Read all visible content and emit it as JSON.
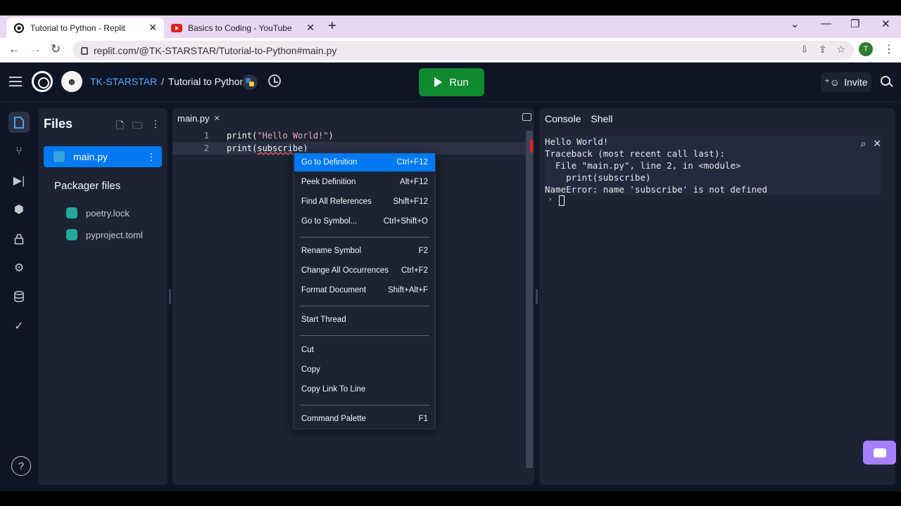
{
  "browser": {
    "tabs": [
      {
        "title": "Tutorial to Python - Replit",
        "active": true
      },
      {
        "title": "Basics to Coding - YouTube",
        "active": false
      }
    ],
    "url": "replit.com/@TK-STARSTAR/Tutorial-to-Python#main.py",
    "profile_initial": "T"
  },
  "header": {
    "owner": "TK-STARSTAR",
    "separator": "/",
    "project": "Tutorial to Python",
    "run_label": "Run",
    "invite_label": "Invite"
  },
  "files": {
    "title": "Files",
    "active_file": "main.py",
    "group_title": "Packager files",
    "items": [
      "poetry.lock",
      "pyproject.toml"
    ]
  },
  "editor": {
    "tab": "main.py",
    "lines": [
      {
        "num": "1",
        "pre": "print(",
        "str": "\"Hello World!\"",
        "post": ")"
      },
      {
        "num": "2",
        "pre": "print(",
        "err": "subscribe",
        "post": ")"
      }
    ]
  },
  "context_menu": {
    "items": [
      {
        "label": "Go to Definition",
        "shortcut": "Ctrl+F12"
      },
      {
        "label": "Peek Definition",
        "shortcut": "Alt+F12"
      },
      {
        "label": "Find All References",
        "shortcut": "Shift+F12"
      },
      {
        "label": "Go to Symbol...",
        "shortcut": "Ctrl+Shift+O"
      },
      {
        "label": "Rename Symbol",
        "shortcut": "F2"
      },
      {
        "label": "Change All Occurrences",
        "shortcut": "Ctrl+F2"
      },
      {
        "label": "Format Document",
        "shortcut": "Shift+Alt+F"
      },
      {
        "label": "Start Thread",
        "shortcut": ""
      },
      {
        "label": "Cut",
        "shortcut": ""
      },
      {
        "label": "Copy",
        "shortcut": ""
      },
      {
        "label": "Copy Link To Line",
        "shortcut": ""
      },
      {
        "label": "Command Palette",
        "shortcut": "F1"
      }
    ]
  },
  "console": {
    "tabs": [
      "Console",
      "Shell"
    ],
    "output": [
      "Hello World!",
      "Traceback (most recent call last):",
      "  File \"main.py\", line 2, in <module>",
      "    print(subscribe)",
      "NameError: name 'subscribe' is not defined"
    ]
  },
  "colors": {
    "accent": "#0079f2",
    "run": "#0f8a2f",
    "bg": "#0e1525",
    "panel": "#1c2333"
  }
}
